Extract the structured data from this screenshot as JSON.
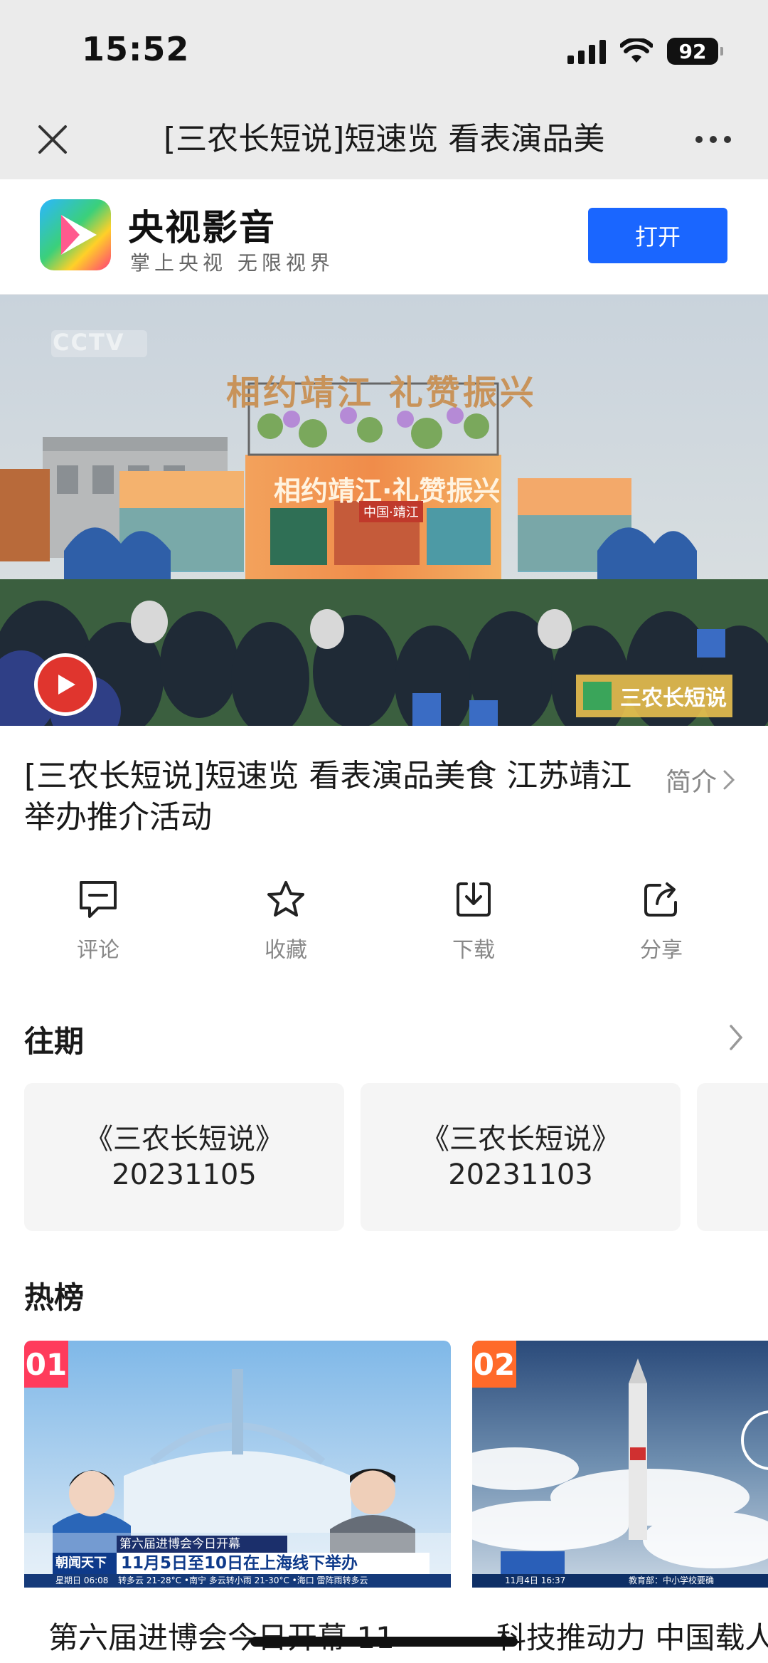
{
  "status_bar": {
    "time": "15:52",
    "battery": "92"
  },
  "nav": {
    "title": "[三农长短说]短速览 看表演品美",
    "close_icon": "close-icon",
    "more_icon": "more-icon"
  },
  "app_banner": {
    "name": "央视影音",
    "slogan": "掌上央视 无限视界",
    "open_label": "打开"
  },
  "video": {
    "watermark": "CCTV",
    "headline": "相约靖江 礼赞振兴",
    "stage_text": "相约靖江·礼赞振兴",
    "stage_sub": "中国·靖江",
    "program_badge": "三农长短说"
  },
  "title": "[三农长短说]短速览 看表演品美食 江苏靖江举办推介活动",
  "intro_label": "简介",
  "actions": [
    {
      "label": "评论",
      "icon": "comment-icon"
    },
    {
      "label": "收藏",
      "icon": "star-icon"
    },
    {
      "label": "下载",
      "icon": "download-icon"
    },
    {
      "label": "分享",
      "icon": "share-icon"
    }
  ],
  "past_section": {
    "title": "往期",
    "episodes": [
      {
        "line1": "《三农长短说》",
        "line2": "20231105"
      },
      {
        "line1": "《三农长短说》",
        "line2": "20231103"
      }
    ]
  },
  "hot_section": {
    "title": "热榜",
    "items": [
      {
        "rank": "01",
        "caption": "第六届进博会今日开幕 11",
        "ticker_top": "第六届进博会今日开幕",
        "ticker_main": "11月5日至10日在上海线下举办",
        "show_name": "朝闻天下",
        "bottom_left": "星期日 06:08",
        "bottom_scroll": "转多云 21-28°C  •南宁 多云转小雨 21-30°C  •海口 雷阵雨转多云",
        "rank_color": "#ff3b5c"
      },
      {
        "rank": "02",
        "caption": "科技推动力 中国载人",
        "bottom_left": "11月4日 16:37",
        "bottom_scroll": "教育部：中小学校要确",
        "rank_color": "#ff6a2a"
      }
    ]
  },
  "colors": {
    "accent": "#1a66ff",
    "muted": "#888888"
  }
}
